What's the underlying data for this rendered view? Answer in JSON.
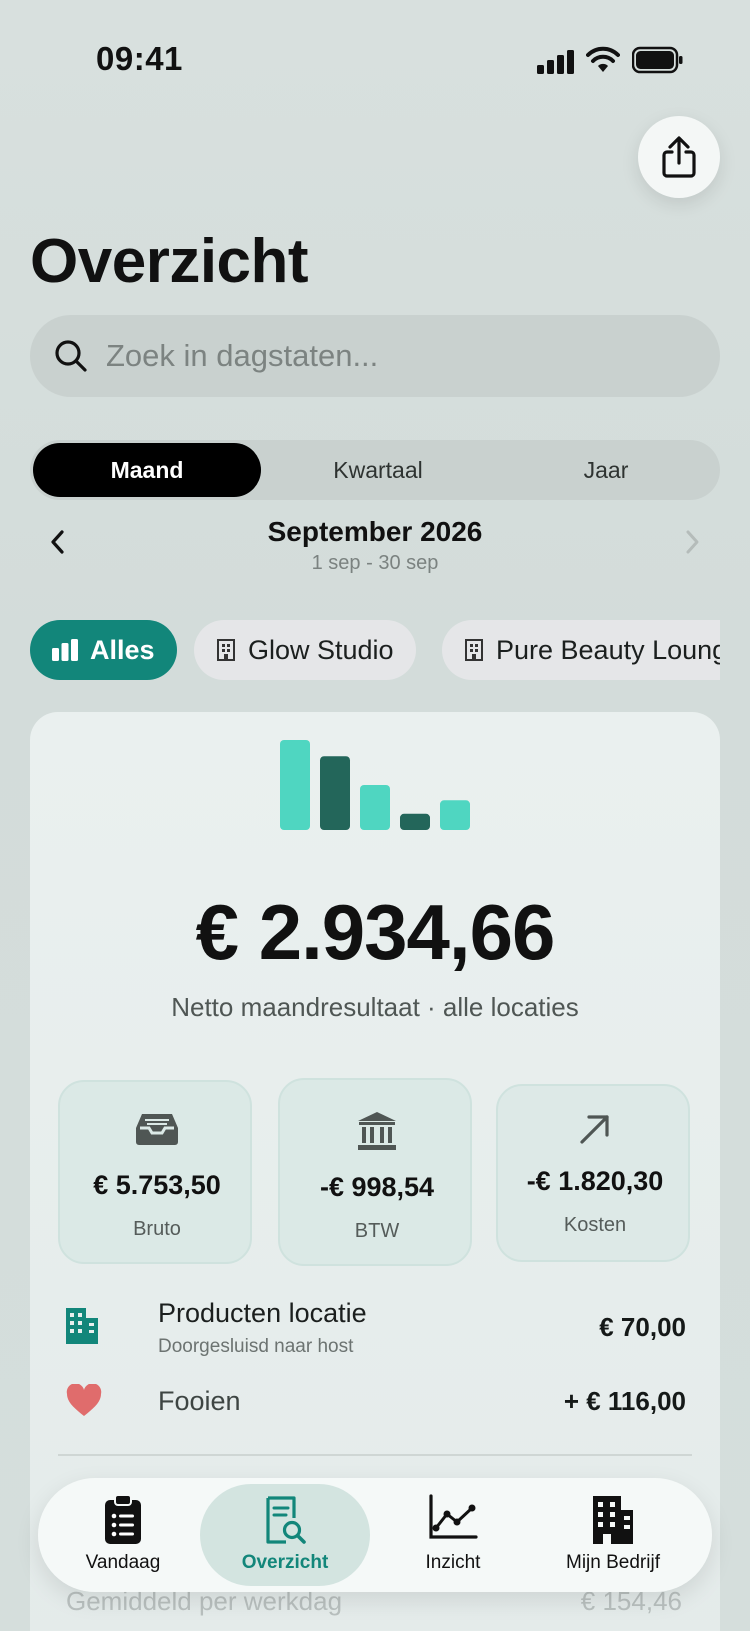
{
  "status_bar": {
    "time": "09:41"
  },
  "header": {
    "title": "Overzicht"
  },
  "search": {
    "placeholder": "Zoek in dagstaten..."
  },
  "period_tabs": [
    {
      "label": "Maand",
      "active": true
    },
    {
      "label": "Kwartaal",
      "active": false
    },
    {
      "label": "Jaar",
      "active": false
    }
  ],
  "period": {
    "title": "September 2026",
    "range": "1 sep - 30 sep"
  },
  "filters": [
    {
      "label": "Alles",
      "icon": "bar-chart-icon",
      "active": true
    },
    {
      "label": "Glow Studio",
      "icon": "building-icon",
      "active": false
    },
    {
      "label": "Pure Beauty Lounge",
      "icon": "building-icon",
      "active": false
    }
  ],
  "summary": {
    "amount": "€ 2.934,66",
    "subtitle": "Netto maandresultaat · alle locaties",
    "mini_bars": [
      1.0,
      0.82,
      0.5,
      0.18,
      0.33
    ],
    "stats": [
      {
        "value": "€ 5.753,50",
        "label": "Bruto",
        "icon": "inbox-tray-icon"
      },
      {
        "value": "-€ 998,54",
        "label": "BTW",
        "icon": "bank-building-icon"
      },
      {
        "value": "-€ 1.820,30",
        "label": "Kosten",
        "icon": "arrow-up-right-icon"
      }
    ],
    "rows": [
      {
        "title": "Producten locatie",
        "subtitle": "Doorgesluisd naar host",
        "value": "€ 70,00",
        "icon": "building-icon"
      },
      {
        "title": "Fooien",
        "value": "+ € 116,00",
        "icon": "heart-icon"
      }
    ],
    "footer_row": {
      "label": "Gemiddeld per werkdag",
      "value": "€ 154,46"
    }
  },
  "tab_bar": [
    {
      "label": "Vandaag",
      "icon": "clipboard-list-icon",
      "active": false
    },
    {
      "label": "Overzicht",
      "icon": "document-search-icon",
      "active": true
    },
    {
      "label": "Inzicht",
      "icon": "line-chart-icon",
      "active": false
    },
    {
      "label": "Mijn Bedrijf",
      "icon": "office-building-icon",
      "active": false
    }
  ],
  "colors": {
    "accent": "#12867a",
    "bar_light": "#4fd6c1",
    "bar_dark": "#23665a",
    "heart": "#e06c6c"
  }
}
